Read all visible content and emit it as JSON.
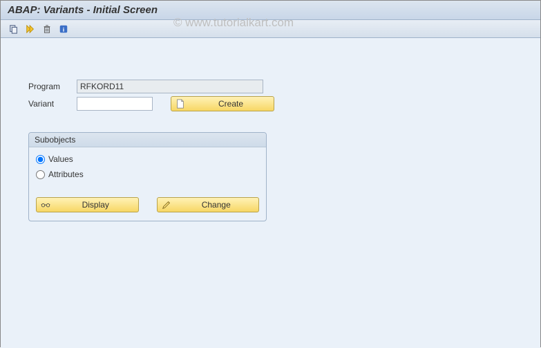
{
  "title": "ABAP: Variants - Initial Screen",
  "watermark": "© www.tutorialkart.com",
  "toolbar": {
    "copy": "copy",
    "execute": "execute",
    "delete": "delete",
    "info": "info"
  },
  "form": {
    "program_label": "Program",
    "program_value": "RFKORD11",
    "variant_label": "Variant",
    "variant_value": "",
    "create_label": "Create"
  },
  "subobjects": {
    "title": "Subobjects",
    "values_label": "Values",
    "attributes_label": "Attributes",
    "selected": "values",
    "display_label": "Display",
    "change_label": "Change"
  }
}
